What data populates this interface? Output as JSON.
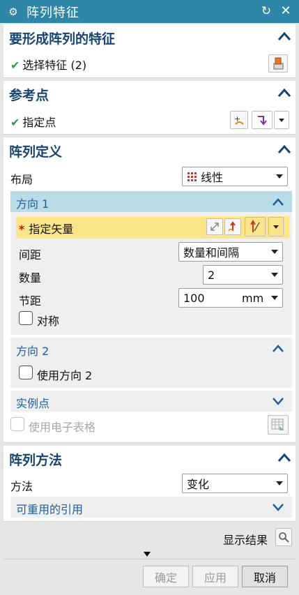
{
  "window": {
    "title": "阵列特征"
  },
  "features": {
    "title": "要形成阵列的特征",
    "select_label": "选择特征 (2)"
  },
  "reference": {
    "title": "参考点",
    "specify_label": "指定点"
  },
  "pattern_def": {
    "title": "阵列定义",
    "layout_label": "布局",
    "layout_value": "线性",
    "direction1": {
      "title": "方向 1",
      "vector_label": "指定矢量",
      "spacing_label": "间距",
      "spacing_value": "数量和间隔",
      "count_label": "数量",
      "count_value": "2",
      "pitch_label": "节距",
      "pitch_value": "100",
      "pitch_unit": "mm",
      "symmetric_label": "对称"
    },
    "direction2": {
      "title": "方向 2",
      "use_label": "使用方向 2"
    },
    "instance_points": {
      "title": "实例点"
    },
    "spreadsheet_label": "使用电子表格"
  },
  "pattern_method": {
    "title": "阵列方法",
    "method_label": "方法",
    "method_value": "变化",
    "reusable_title": "可重用的引用"
  },
  "results": {
    "show_label": "显示结果"
  },
  "buttons": {
    "ok": "确定",
    "apply": "应用",
    "cancel": "取消"
  },
  "colors": {
    "titlebar": "#2e87a8",
    "section_title": "#17456d",
    "subheader": "#b9dce7",
    "required_row": "#fde58a",
    "check": "#2aa040"
  }
}
